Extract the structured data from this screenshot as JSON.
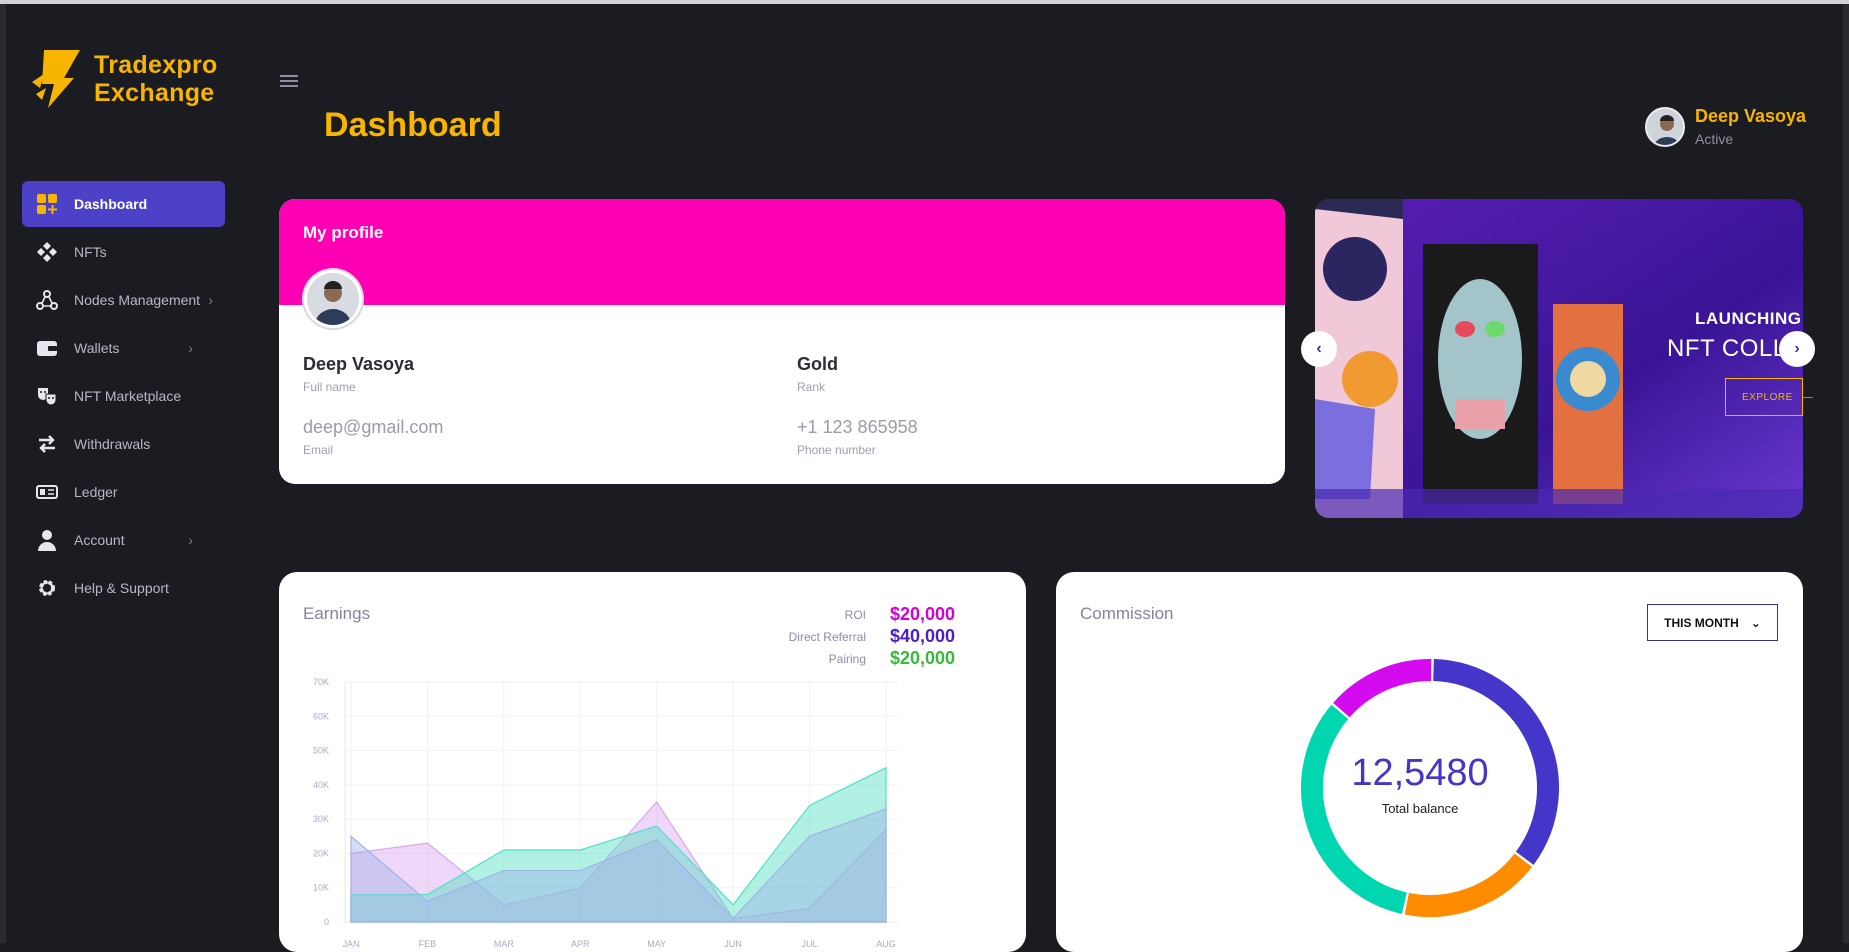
{
  "brand": {
    "name_line1": "Tradexpro",
    "name_line2": "Exchange",
    "color": "#f7b500"
  },
  "sidebar": {
    "items": [
      {
        "label": "Dashboard",
        "icon": "dashboard-grid-icon",
        "active": true
      },
      {
        "label": "NFTs",
        "icon": "diamond-shapes-icon"
      },
      {
        "label": "Nodes Management",
        "icon": "nodes-icon",
        "has_children": true
      },
      {
        "label": "Wallets",
        "icon": "wallet-icon",
        "has_children": true
      },
      {
        "label": "NFT Marketplace",
        "icon": "masks-icon"
      },
      {
        "label": "Withdrawals",
        "icon": "swap-arrows-icon"
      },
      {
        "label": "Ledger",
        "icon": "ledger-icon"
      },
      {
        "label": "Account",
        "icon": "user-icon",
        "has_children": true
      },
      {
        "label": "Help & Support",
        "icon": "gear-icon"
      }
    ]
  },
  "header": {
    "title": "Dashboard",
    "user": {
      "name": "Deep Vasoya",
      "status": "Active"
    }
  },
  "profile": {
    "title": "My profile",
    "full_name": "Deep Vasoya",
    "full_name_label": "Full name",
    "rank": "Gold",
    "rank_label": "Rank",
    "email": "deep@gmail.com",
    "email_label": "Email",
    "phone": "+1 123 865958",
    "phone_label": "Phone number"
  },
  "banner": {
    "line1": "LAUNCHING",
    "line2": "NFT COLL",
    "button": "EXPLORE"
  },
  "earnings": {
    "title": "Earnings",
    "legend": [
      {
        "label": "ROI",
        "value": "$20,000",
        "color": "#d400d4"
      },
      {
        "label": "Direct Referral",
        "value": "$40,000",
        "color": "#4a1fc8"
      },
      {
        "label": "Pairing",
        "value": "$20,000",
        "color": "#3cb83c"
      }
    ]
  },
  "commission": {
    "title": "Commission",
    "select_value": "THIS MONTH",
    "total": "12,5480",
    "total_label": "Total balance"
  },
  "chart_data": [
    {
      "type": "area",
      "title": "Earnings",
      "x": [
        "JAN",
        "FEB",
        "MAR",
        "APR",
        "MAY",
        "JUN",
        "JUL",
        "AUG"
      ],
      "ylim": [
        0,
        70000
      ],
      "yticks": [
        "70K",
        "60K",
        "50K",
        "40K",
        "30K",
        "20K",
        "10K",
        "0"
      ],
      "series": [
        {
          "values": [
            20000,
            23000,
            5000,
            10000,
            35000,
            1000,
            4000,
            27000
          ],
          "color": "#d9a6ef"
        },
        {
          "values": [
            8000,
            8000,
            21000,
            21000,
            28000,
            5000,
            34000,
            45000
          ],
          "color": "#4fe0c4"
        },
        {
          "values": [
            25000,
            6000,
            15000,
            15000,
            24000,
            1000,
            25000,
            33000
          ],
          "color": "#9fb3e6"
        }
      ],
      "grid": true
    },
    {
      "type": "pie",
      "title": "Commission",
      "slices": [
        {
          "value": 35,
          "color": "#4336c8"
        },
        {
          "value": 18,
          "color": "#ff8c00"
        },
        {
          "value": 33,
          "color": "#00d6b0"
        },
        {
          "value": 14,
          "color": "#d40aef"
        }
      ]
    }
  ]
}
